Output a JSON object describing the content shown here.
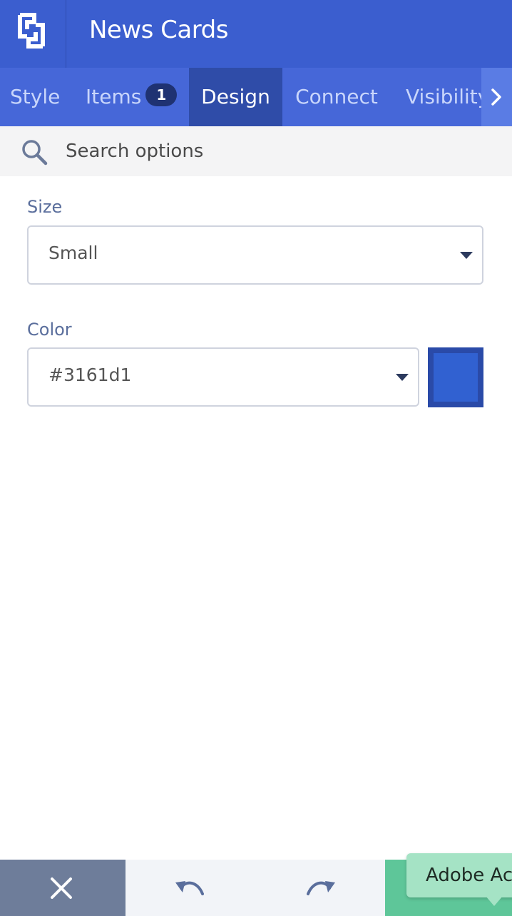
{
  "header": {
    "title": "News Cards",
    "logo_icon": "app-logo-icon",
    "color": "#3b5ecf"
  },
  "tabs": [
    {
      "label": "Style",
      "active": false
    },
    {
      "label": "Items",
      "badge": "1",
      "active": false
    },
    {
      "label": "Design",
      "active": true
    },
    {
      "label": "Connect",
      "active": false
    },
    {
      "label": "Visibility",
      "active": false
    }
  ],
  "search": {
    "placeholder": "Search options",
    "value": "",
    "icon": "search-icon"
  },
  "fields": {
    "size": {
      "label": "Size",
      "value": "Small"
    },
    "color": {
      "label": "Color",
      "value": "#3161d1",
      "swatch": "#3161d1"
    }
  },
  "footer": {
    "close_icon": "close-icon",
    "undo_icon": "undo-icon",
    "redo_icon": "redo-icon",
    "tooltip": "Adobe Ac"
  }
}
